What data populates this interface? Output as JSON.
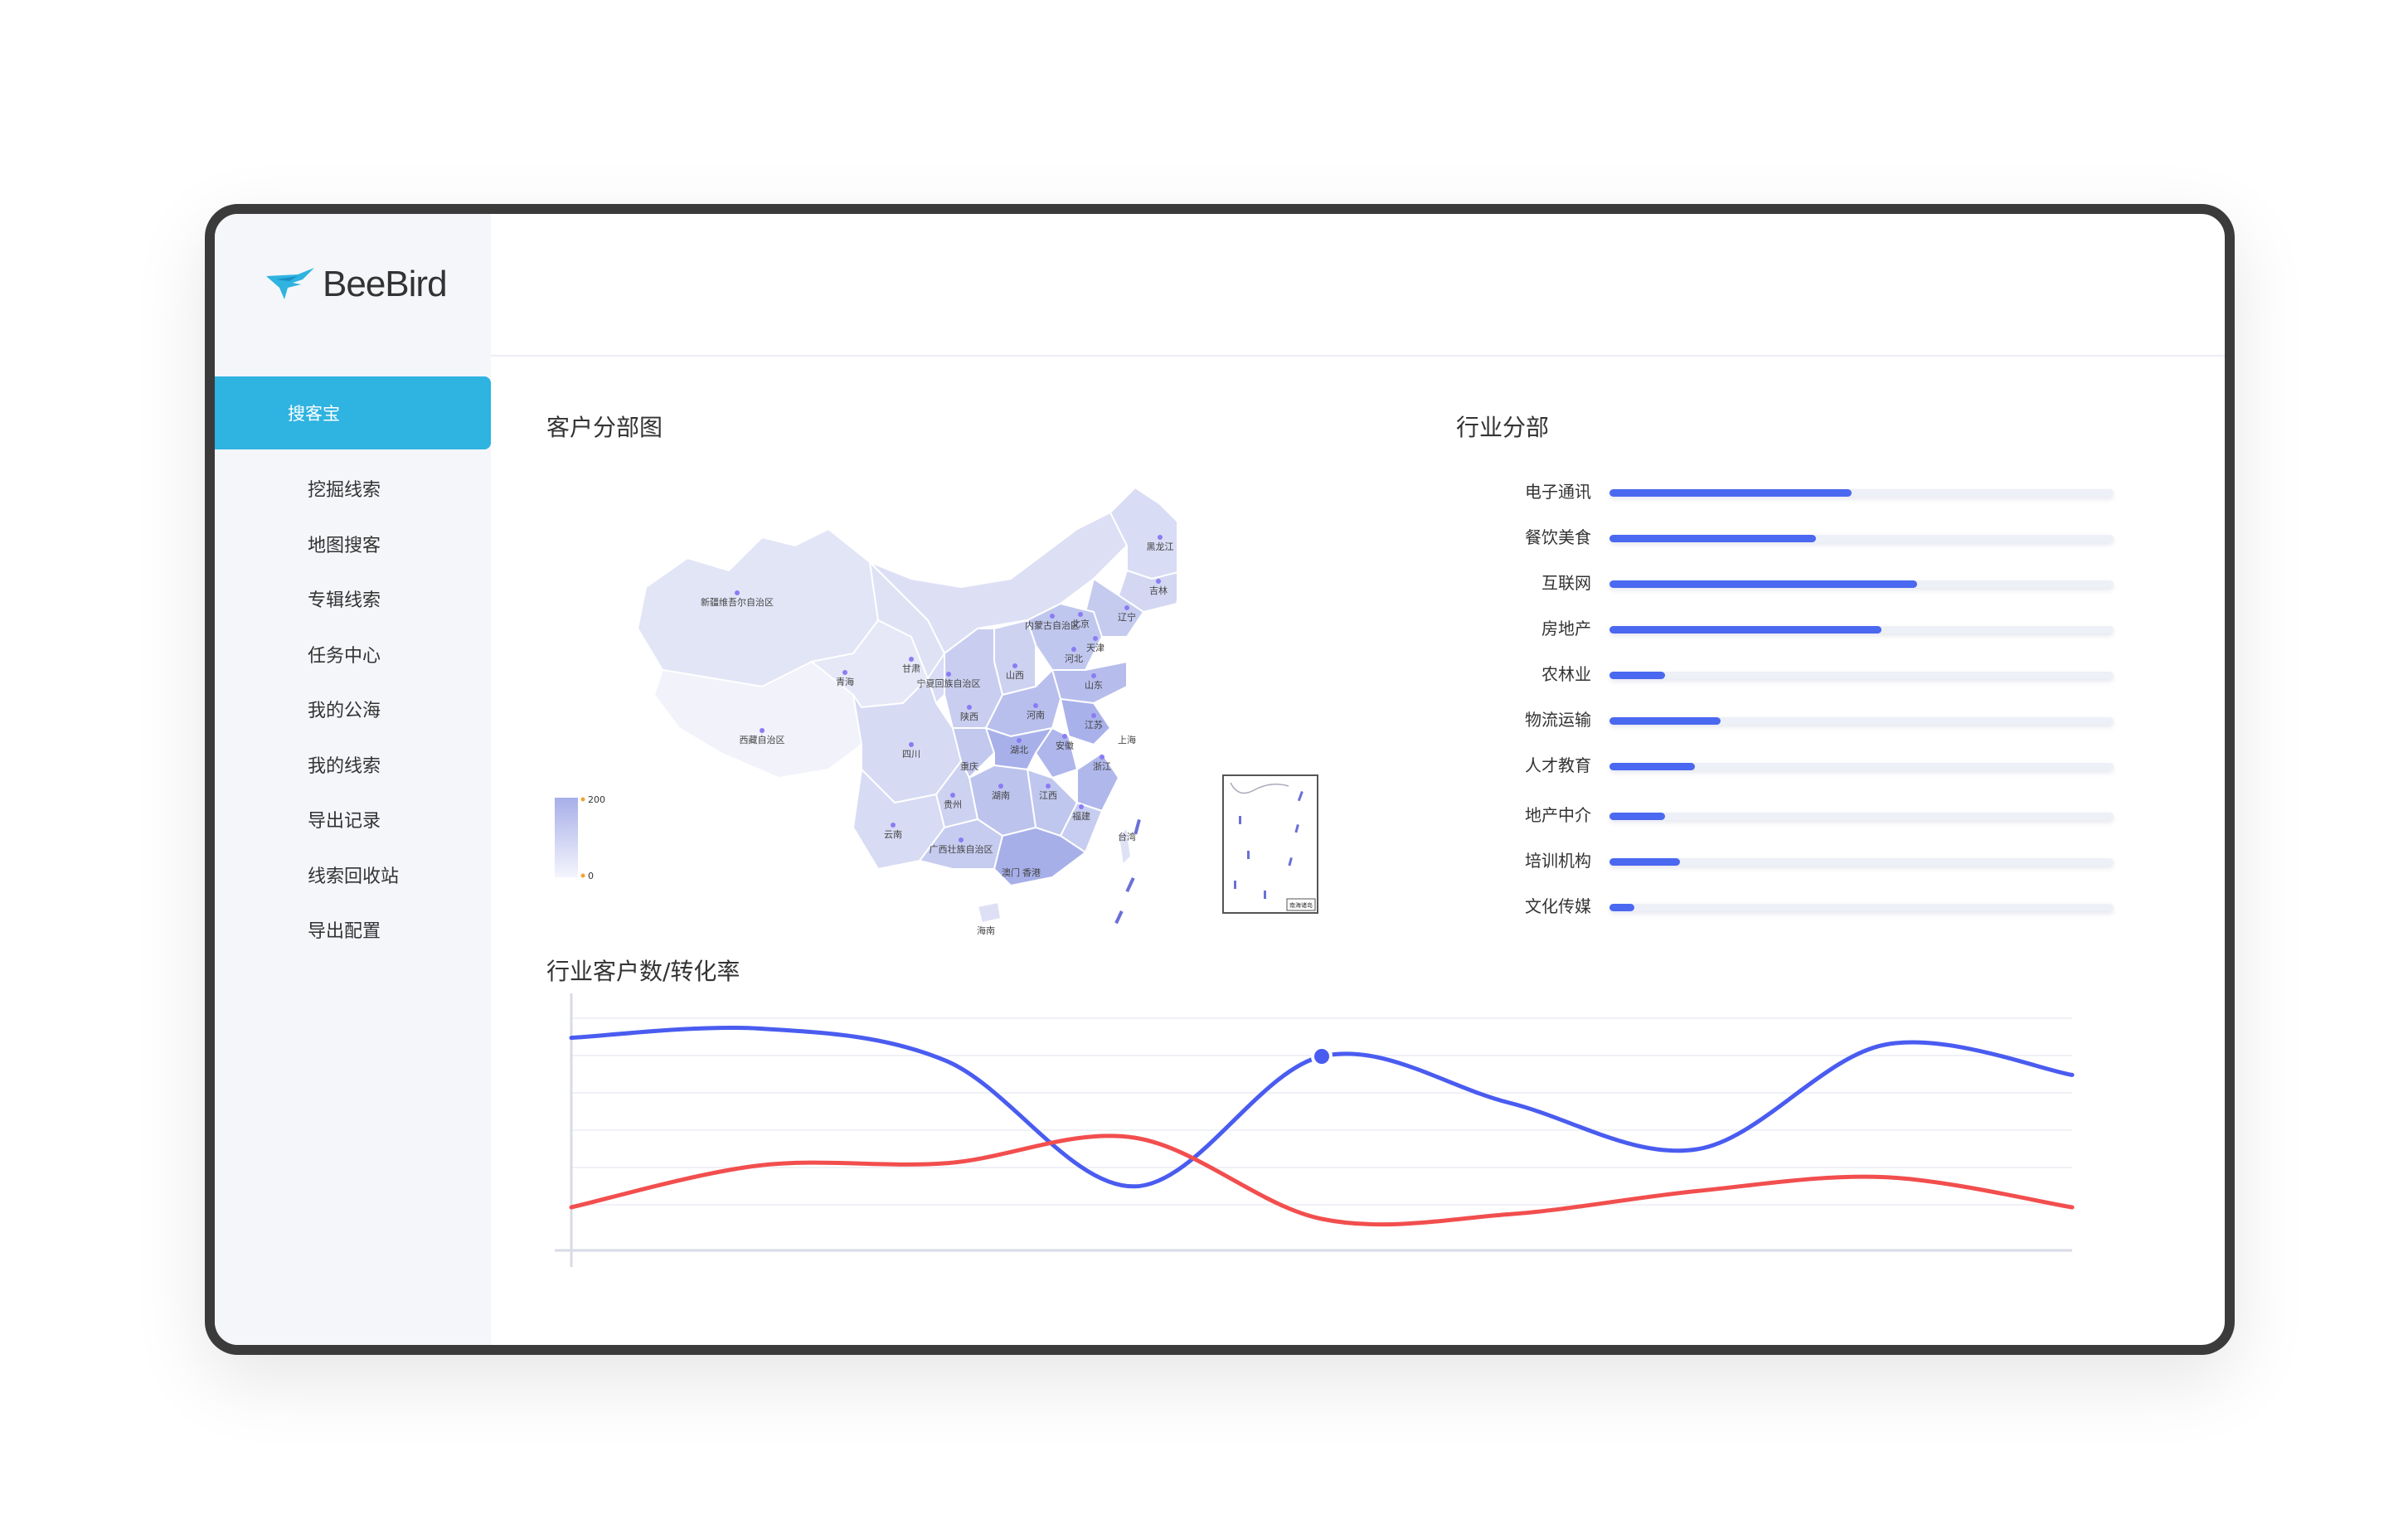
{
  "app": {
    "logo_text": "BeeBird"
  },
  "sidebar": {
    "active_label": "搜客宝",
    "items": [
      {
        "label": "挖掘线索"
      },
      {
        "label": "地图搜客"
      },
      {
        "label": "专辑线索"
      },
      {
        "label": "任务中心"
      },
      {
        "label": "我的公海"
      },
      {
        "label": "我的线索"
      },
      {
        "label": "导出记录"
      },
      {
        "label": "线索回收站"
      },
      {
        "label": "导出配置"
      }
    ]
  },
  "header": {
    "avatar_icon": "bird-logo-icon",
    "status_color": "#4cd964"
  },
  "map_section": {
    "title": "客户分部图",
    "legend_max": "200",
    "legend_min": "0",
    "provinces": [
      {
        "name": "黑龙江"
      },
      {
        "name": "吉林"
      },
      {
        "name": "辽宁"
      },
      {
        "name": "内蒙古自治区"
      },
      {
        "name": "北京"
      },
      {
        "name": "天津"
      },
      {
        "name": "河北"
      },
      {
        "name": "新疆维吾尔自治区"
      },
      {
        "name": "甘肃"
      },
      {
        "name": "青海"
      },
      {
        "name": "宁夏回族自治区"
      },
      {
        "name": "山西"
      },
      {
        "name": "山东"
      },
      {
        "name": "陕西"
      },
      {
        "name": "河南"
      },
      {
        "name": "江苏"
      },
      {
        "name": "上海"
      },
      {
        "name": "安徽"
      },
      {
        "name": "西藏自治区"
      },
      {
        "name": "四川"
      },
      {
        "name": "湖北"
      },
      {
        "name": "重庆"
      },
      {
        "name": "浙江"
      },
      {
        "name": "贵州"
      },
      {
        "name": "湖南"
      },
      {
        "name": "江西"
      },
      {
        "name": "福建"
      },
      {
        "name": "云南"
      },
      {
        "name": "广西壮族自治区"
      },
      {
        "name": "台湾"
      },
      {
        "name": "澳门"
      },
      {
        "name": "香港"
      },
      {
        "name": "海南"
      }
    ],
    "inset_label": "南海诸岛"
  },
  "industry_section": {
    "title": "行业分部",
    "items": [
      {
        "label": "电子通讯",
        "value": 0.48
      },
      {
        "label": "餐饮美食",
        "value": 0.41
      },
      {
        "label": "互联网",
        "value": 0.61
      },
      {
        "label": "房地产",
        "value": 0.54
      },
      {
        "label": "农林业",
        "value": 0.11
      },
      {
        "label": "物流运输",
        "value": 0.22
      },
      {
        "label": "人才教育",
        "value": 0.17
      },
      {
        "label": "地产中介",
        "value": 0.11
      },
      {
        "label": "培训机构",
        "value": 0.14
      },
      {
        "label": "文化传媒",
        "value": 0.05
      }
    ],
    "bar_color": "#4a68f0"
  },
  "chart_section": {
    "title": "行业客户数/转化率"
  },
  "chart_data": {
    "type": "line",
    "title": "行业客户数/转化率",
    "xlabel": "",
    "ylabel": "",
    "grid": true,
    "x": [
      0,
      1,
      2,
      3,
      4,
      5,
      6,
      7,
      8
    ],
    "ylim": [
      0,
      100
    ],
    "series": [
      {
        "color": "#4a5cf0",
        "values": [
          88,
          92,
          78,
          24,
          80,
          60,
          40,
          85,
          72
        ],
        "highlight_index": 4
      },
      {
        "color": "#f24e4e",
        "values": [
          15,
          33,
          34,
          45,
          10,
          12,
          22,
          28,
          15
        ]
      }
    ]
  }
}
